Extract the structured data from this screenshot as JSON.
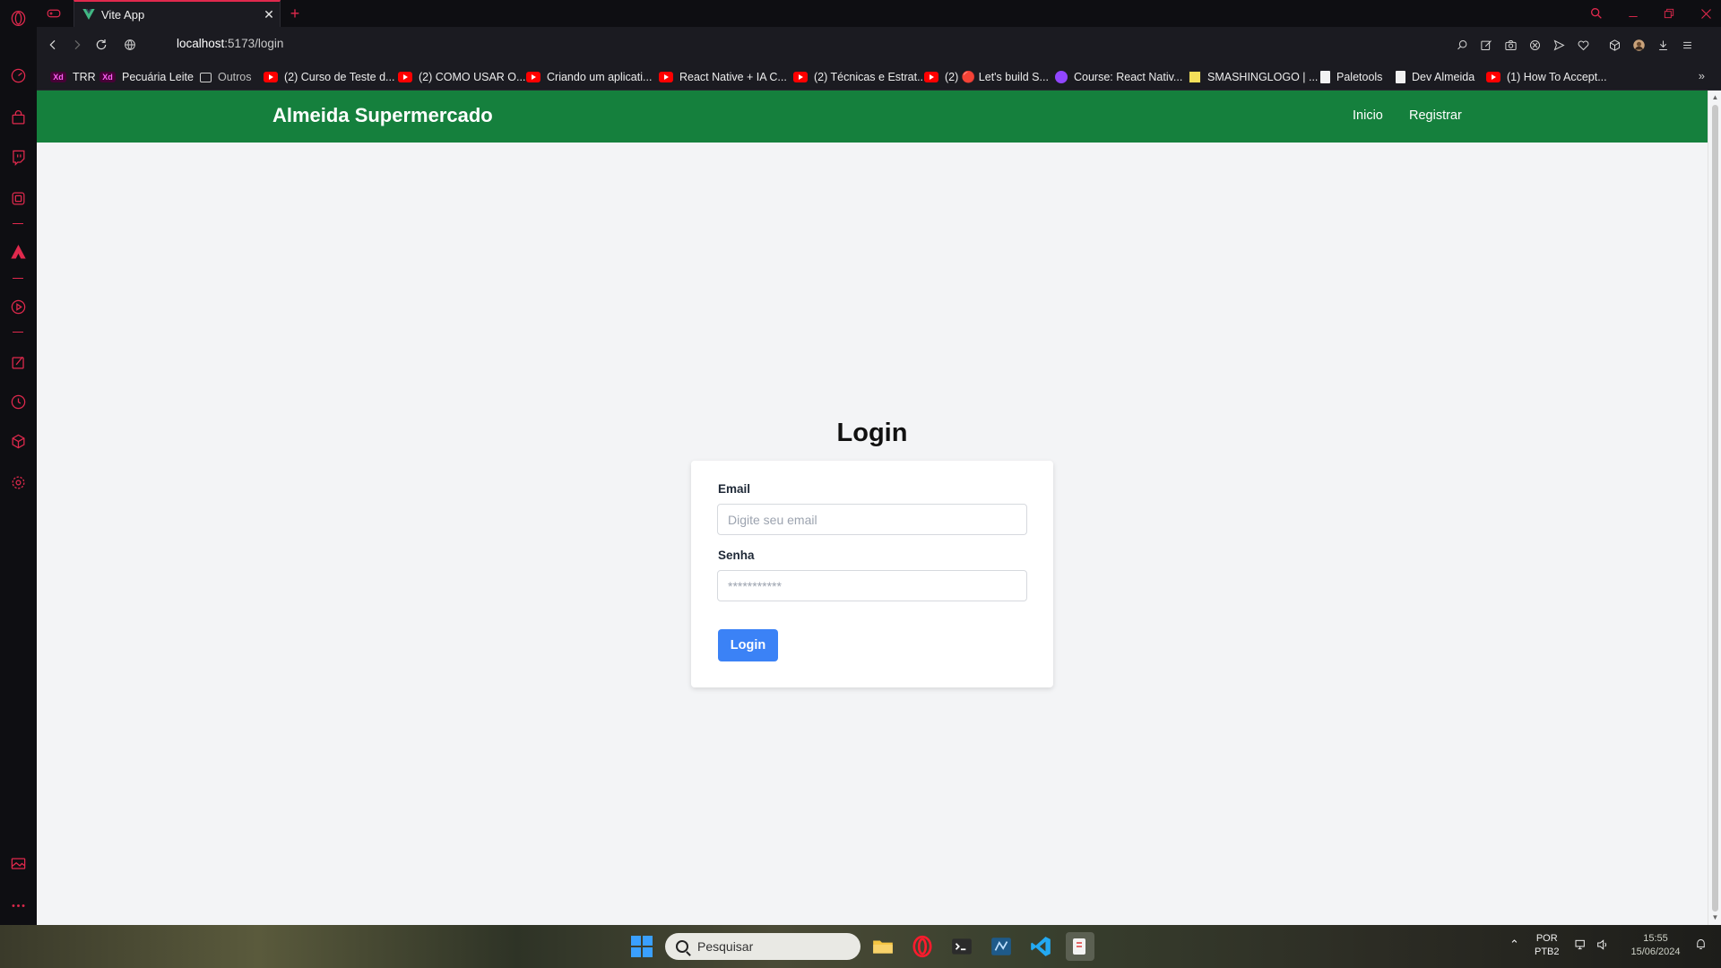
{
  "browser": {
    "tab_title": "Vite App",
    "tab_close": "✕",
    "new_tab": "+",
    "url_host": "localhost",
    "url_path": ":5173/login",
    "more_bookmarks": "»"
  },
  "bookmarks": [
    {
      "label": "TRR",
      "icon": "xd"
    },
    {
      "label": "Pecuária Leite",
      "icon": "xd"
    },
    {
      "label": "Outros",
      "icon": "folder"
    },
    {
      "label": "(2) Curso de Teste d...",
      "icon": "yt"
    },
    {
      "label": "(2) COMO USAR O...",
      "icon": "yt"
    },
    {
      "label": "Criando um aplicati...",
      "icon": "yt"
    },
    {
      "label": "React Native + IA C...",
      "icon": "yt"
    },
    {
      "label": "(2) Técnicas e Estrat...",
      "icon": "yt"
    },
    {
      "label": "(2) 🔴 Let's build S...",
      "icon": "yt"
    },
    {
      "label": "Course: React Nativ...",
      "icon": "twitch"
    },
    {
      "label": "SMASHINGLOGO | ...",
      "icon": "smashing"
    },
    {
      "label": "Paletools",
      "icon": "file"
    },
    {
      "label": "Dev Almeida",
      "icon": "file"
    },
    {
      "label": "(1) How To Accept...",
      "icon": "yt"
    }
  ],
  "app": {
    "brand": "Almeida Supermercado",
    "nav": [
      "Inicio",
      "Registrar"
    ],
    "title": "Login",
    "form": {
      "email_label": "Email",
      "email_placeholder": "Digite seu email",
      "password_label": "Senha",
      "password_placeholder": "***********",
      "submit_label": "Login"
    }
  },
  "taskbar": {
    "search_placeholder": "Pesquisar",
    "lang_top": "POR",
    "lang_bottom": "PTB2",
    "time": "15:55",
    "date": "15/06/2024"
  },
  "colors": {
    "navbar": "#15803d",
    "button": "#3b82f6",
    "page_bg": "#f3f4f6",
    "browser_accent": "#e0294d"
  }
}
